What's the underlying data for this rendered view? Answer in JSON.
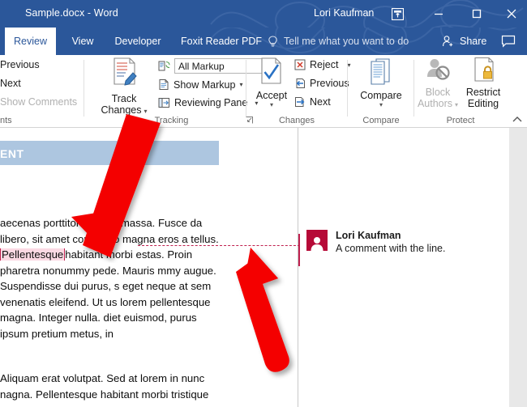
{
  "window": {
    "title": "Sample.docx  -  Word",
    "user": "Lori Kaufman",
    "controls": {
      "ribbon_display": "ribbon-display-options-icon",
      "minimize": "minimize-icon",
      "maximize": "maximize-icon",
      "close": "close-icon"
    }
  },
  "tabs": [
    {
      "label": "Review",
      "active": true
    },
    {
      "label": "View",
      "active": false
    },
    {
      "label": "Developer",
      "active": false
    },
    {
      "label": "Foxit Reader PDF",
      "active": false
    }
  ],
  "tellme": {
    "label": "Tell me what you want to do",
    "icon": "lightbulb-icon"
  },
  "share": {
    "label": "Share",
    "icon": "person-add-icon"
  },
  "comment_bubble": {
    "icon": "comment-bubble-icon"
  },
  "ribbon": {
    "groups": {
      "comments": {
        "label": "nts",
        "items": [
          {
            "label": "Previous",
            "disabled": false
          },
          {
            "label": "Next",
            "disabled": false
          },
          {
            "label": "Show Comments",
            "disabled": true
          }
        ]
      },
      "tracking": {
        "label": "Tracking",
        "track_changes": {
          "line1": "Track",
          "line2": "Changes"
        },
        "markup_dropdown": {
          "value": "All Markup"
        },
        "show_markup": {
          "label": "Show Markup"
        },
        "reviewing_pane": {
          "label": "Reviewing Pane"
        },
        "launcher": "dialog-launcher-icon"
      },
      "changes": {
        "label": "Changes",
        "accept": {
          "label": "Accept"
        },
        "reject": {
          "label": "Reject"
        },
        "previous": {
          "label": "Previous"
        },
        "next": {
          "label": "Next"
        }
      },
      "compare": {
        "label": "Compare",
        "button": {
          "label": "Compare"
        }
      },
      "protect": {
        "label": "Protect",
        "block_authors": {
          "line1": "Block",
          "line2": "Authors",
          "disabled": true
        },
        "restrict_editing": {
          "line1": "Restrict",
          "line2": "Editing",
          "disabled": false
        }
      }
    },
    "collapse": {
      "icon": "chevron-up-icon"
    }
  },
  "document": {
    "heading": "ENT",
    "paragraph1_pre": "aecenas porttitor congue massa. Fusce da libero, sit amet commodo magna eros a tellus. ",
    "commented_word": "Pellentesque",
    "paragraph1_post": "habitant morbi estas. Proin pharetra nonummy pede. Mauris mmy augue. Suspendisse dui purus, s eget neque at sem venenatis eleifend. Ut us lorem pellentesque magna. Integer nulla. diet euismod, purus ipsum pretium metus, in",
    "paragraph2": "Aliquam erat volutpat. Sed at lorem in nunc nagna. Pellentesque habitant morbi tristique",
    "comment": {
      "author": "Lori Kaufman",
      "text": "A comment with the line.",
      "avatar_icon": "person-avatar-icon"
    }
  },
  "annotations": {
    "arrow_top": {
      "name": "arrow-pointing-to-commented-text"
    },
    "arrow_bottom": {
      "name": "arrow-pointing-to-comment-line"
    }
  },
  "colors": {
    "word_blue": "#2b579a",
    "comment_red": "#c0204f",
    "avatar_red": "#b60a37",
    "heading_blue": "#adc6e0",
    "arrow_red": "#f40000",
    "highlight_pink": "#fbd9e3"
  }
}
